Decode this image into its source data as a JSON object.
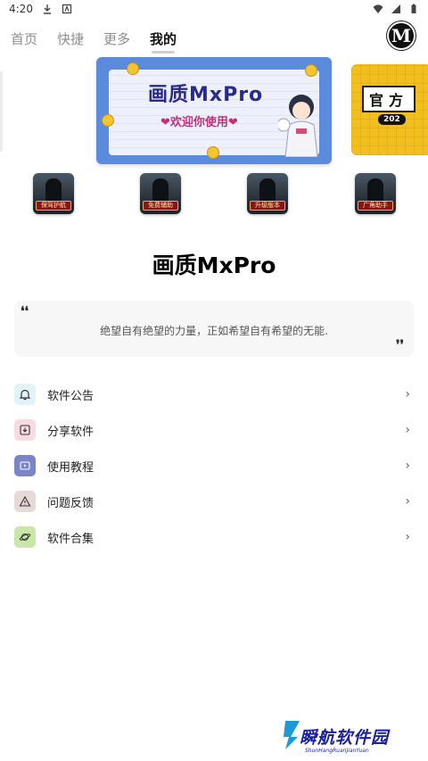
{
  "status_bar": {
    "time": "4:20"
  },
  "tabs": [
    {
      "label": "首页",
      "active": false
    },
    {
      "label": "快捷",
      "active": false
    },
    {
      "label": "更多",
      "active": false
    },
    {
      "label": "我的",
      "active": true
    }
  ],
  "header": {
    "logo_letter": "M"
  },
  "banner": {
    "title": "画质MxPro",
    "subtitle": "❤欢迎你使用❤",
    "next_label": "官方",
    "next_year": "202"
  },
  "games": [
    {
      "tag": "保驾护航"
    },
    {
      "tag": "免费辅助"
    },
    {
      "tag": "升级版本"
    },
    {
      "tag": "广角助手"
    }
  ],
  "app_title": "画质MxPro",
  "quote": {
    "text": "绝望自有绝望的力量，正如希望自有希望的无能."
  },
  "menu": [
    {
      "label": "软件公告",
      "icon": "bell-icon",
      "color": "#e2f3f7"
    },
    {
      "label": "分享软件",
      "icon": "share-download-icon",
      "color": "#f8dbe0"
    },
    {
      "label": "使用教程",
      "icon": "video-play-icon",
      "color": "#7a84c7"
    },
    {
      "label": "问题反馈",
      "icon": "warning-triangle-icon",
      "color": "#e7dad6"
    },
    {
      "label": "软件合集",
      "icon": "planet-icon",
      "color": "#c9e7a8"
    }
  ],
  "watermark": {
    "title": "瞬航软件园",
    "subtitle": "ShunHangRuanJianYuan"
  }
}
